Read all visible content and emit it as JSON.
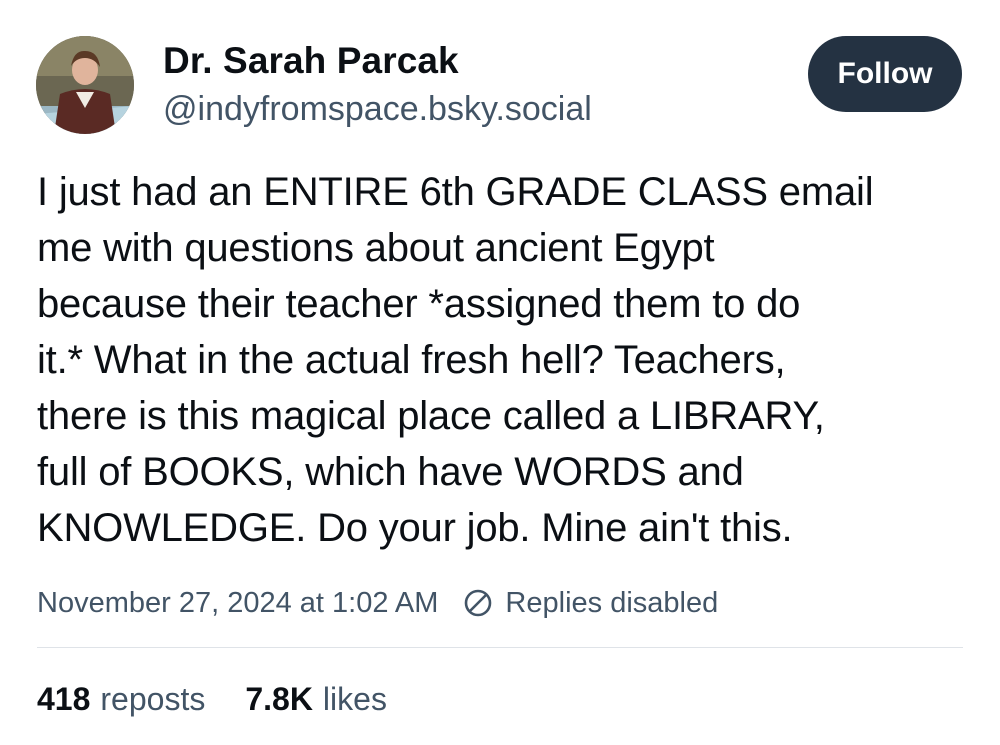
{
  "author": {
    "display_name": "Dr. Sarah Parcak",
    "handle": "@indyfromspace.bsky.social",
    "avatar_icon": "profile-photo"
  },
  "follow_button": {
    "label": "Follow",
    "background": "#243242"
  },
  "post": {
    "text": "I just had an ENTIRE 6th GRADE CLASS email\nme with questions about ancient Egypt\nbecause their teacher *assigned them to do\nit.* What in the actual fresh hell? Teachers,\nthere is this magical place called a LIBRARY,\nfull of BOOKS, which have WORDS and\nKNOWLEDGE. Do your job. Mine ain't this."
  },
  "meta": {
    "timestamp": "November 27, 2024 at 1:02 AM",
    "replies_status": "Replies disabled",
    "replies_icon": "no-entry-icon"
  },
  "stats": {
    "reposts_count": "418",
    "reposts_label": "reposts",
    "likes_count": "7.8K",
    "likes_label": "likes"
  },
  "colors": {
    "text_primary": "#0b0f14",
    "text_secondary": "#425466",
    "divider": "#dfe3e8"
  }
}
